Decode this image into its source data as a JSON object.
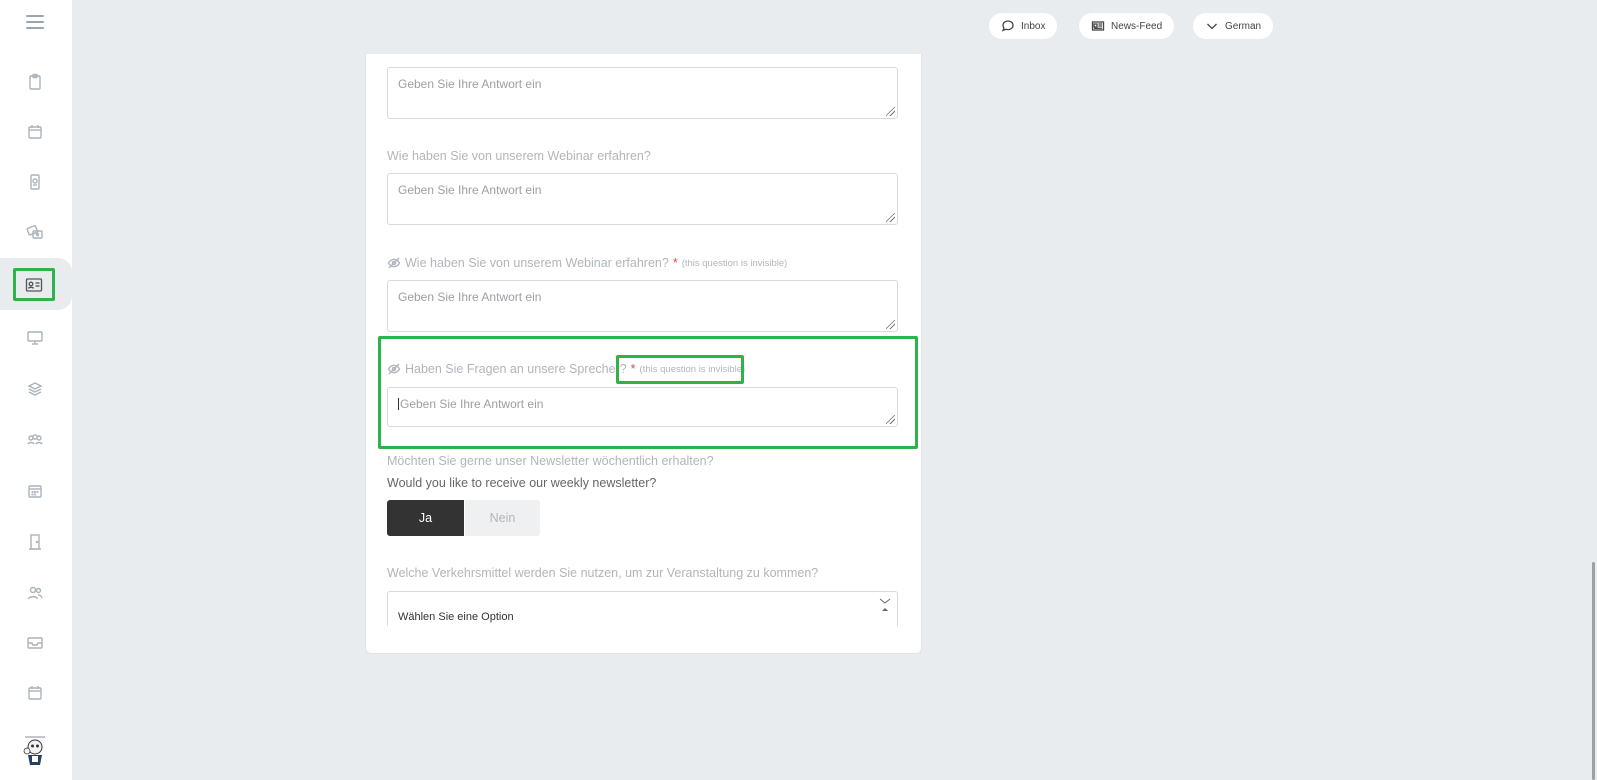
{
  "topbar": {
    "inbox_label": "Inbox",
    "newsfeed_label": "News-Feed",
    "language_label": "German"
  },
  "form": {
    "placeholder": "Geben Sie Ihre Antwort ein",
    "q2_label": "Wie haben Sie von unserem Webinar erfahren?",
    "q3_label": "Wie haben Sie von unserem Webinar erfahren?",
    "q3_required": "*",
    "q3_note": "(this question is invisible)",
    "q4_label": "Haben Sie Fragen an unsere Sprecher?",
    "q4_required": "*",
    "q4_note": "(this question is invisible)",
    "newsletter_label_de": "Möchten Sie gerne unser Newsletter wöchentlich erhalten?",
    "newsletter_label_en": "Would you like to receive our weekly newsletter?",
    "yes_label": "Ja",
    "no_label": "Nein",
    "transport_label": "Welche Verkehrsmittel werden Sie nutzen, um zur Veranstaltung zu kommen?",
    "transport_select_value": "Wählen Sie eine Option"
  },
  "colors": {
    "accent_highlight": "#2db34a",
    "required": "#e24b4b",
    "selected_toggle": "#333333"
  },
  "icons": {
    "sidebar": [
      "menu-icon",
      "clipboard-icon",
      "calendar-icon",
      "badge-icon",
      "tickets-icon",
      "contact-card-icon",
      "monitor-icon",
      "layers-icon",
      "group-icon",
      "schedule-icon",
      "door-icon",
      "users-icon",
      "inbox-tray-icon",
      "calendar-small-icon",
      "mascot-icon"
    ]
  }
}
